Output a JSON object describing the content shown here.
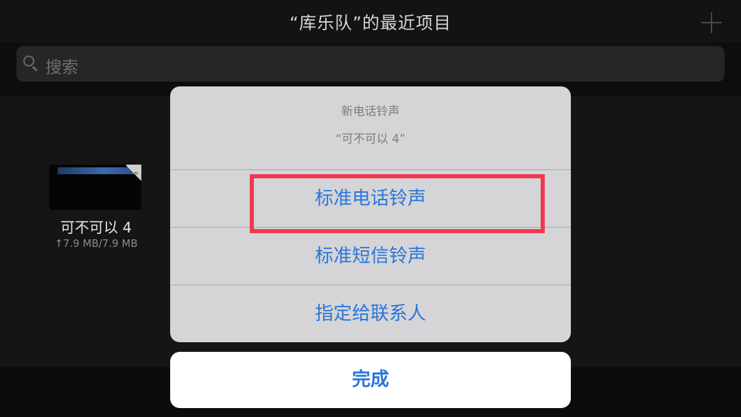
{
  "header": {
    "title": "“库乐队”的最近项目",
    "add_icon": "plus-icon"
  },
  "search": {
    "placeholder": "搜索",
    "icon": "search-icon"
  },
  "file": {
    "name": "可不可以 4",
    "size": "↑7.9 MB/7.9 MB",
    "cloud_icon": "cloud-icon"
  },
  "action_sheet": {
    "title": "新电话铃声",
    "message": "“可不可以 4”",
    "actions": [
      {
        "label": "标准电话铃声"
      },
      {
        "label": "标准短信铃声"
      },
      {
        "label": "指定给联系人"
      }
    ],
    "cancel_label": "完成"
  },
  "colors": {
    "action_blue": "#2a76d9",
    "highlight_red": "#f03a4e",
    "sheet_background": "#d5d5d7"
  }
}
